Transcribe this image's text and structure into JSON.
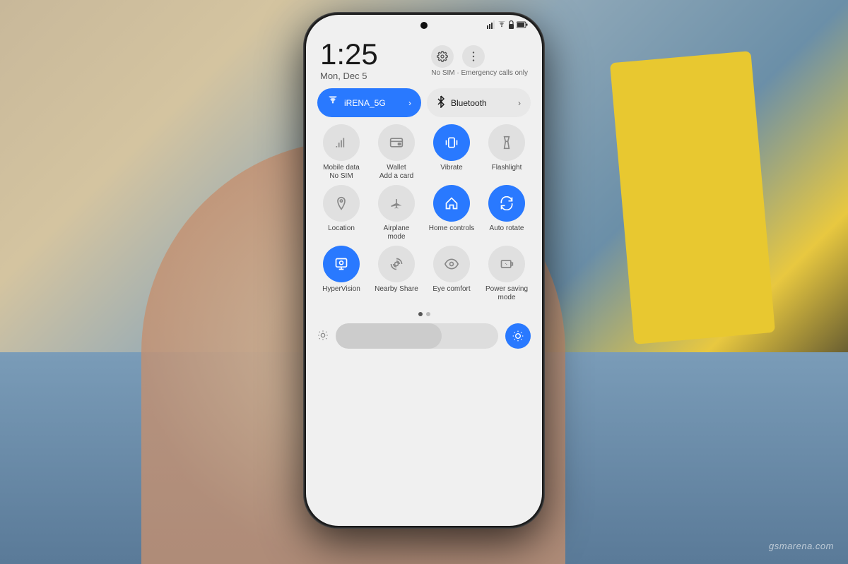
{
  "background": {
    "colors": [
      "#c8b89a",
      "#8fa8b8",
      "#e8c840",
      "#2a2a2a"
    ]
  },
  "watermark": {
    "text": "gsmarena.com"
  },
  "phone": {
    "status_bar": {
      "icons": [
        "signal",
        "wifi",
        "lock",
        "battery"
      ]
    },
    "clock": {
      "time": "1:25",
      "date": "Mon, Dec 5",
      "sim_status": "No SIM · Emergency calls only"
    },
    "quick_tiles_top": [
      {
        "id": "wifi",
        "label": "iRENA_5G",
        "active": true,
        "icon": "wifi"
      },
      {
        "id": "bluetooth",
        "label": "Bluetooth",
        "active": false,
        "icon": "bluetooth"
      }
    ],
    "quick_tiles_grid": [
      {
        "id": "mobile_data",
        "label": "Mobile data\nNo SIM",
        "active": false,
        "icon": "mobile_data"
      },
      {
        "id": "wallet",
        "label": "Wallet\nAdd a card",
        "active": false,
        "icon": "wallet"
      },
      {
        "id": "vibrate",
        "label": "Vibrate",
        "active": true,
        "icon": "vibrate"
      },
      {
        "id": "flashlight",
        "label": "Flashlight",
        "active": false,
        "icon": "flashlight"
      },
      {
        "id": "location",
        "label": "Location",
        "active": false,
        "icon": "location"
      },
      {
        "id": "airplane",
        "label": "Airplane\nmode",
        "active": false,
        "icon": "airplane"
      },
      {
        "id": "home_controls",
        "label": "Home controls",
        "active": true,
        "icon": "home"
      },
      {
        "id": "auto_rotate",
        "label": "Auto rotate",
        "active": true,
        "icon": "rotate"
      },
      {
        "id": "hypervision",
        "label": "HyperVision",
        "active": true,
        "icon": "hypervision"
      },
      {
        "id": "nearby_share",
        "label": "Nearby Share",
        "active": false,
        "icon": "nearby"
      },
      {
        "id": "eye_comfort",
        "label": "Eye comfort",
        "active": false,
        "icon": "eye"
      },
      {
        "id": "power_saving",
        "label": "Power saving\nmode",
        "active": false,
        "icon": "battery_save"
      }
    ],
    "pagination": {
      "current": 0,
      "total": 2
    },
    "brightness": {
      "level": 65
    }
  }
}
